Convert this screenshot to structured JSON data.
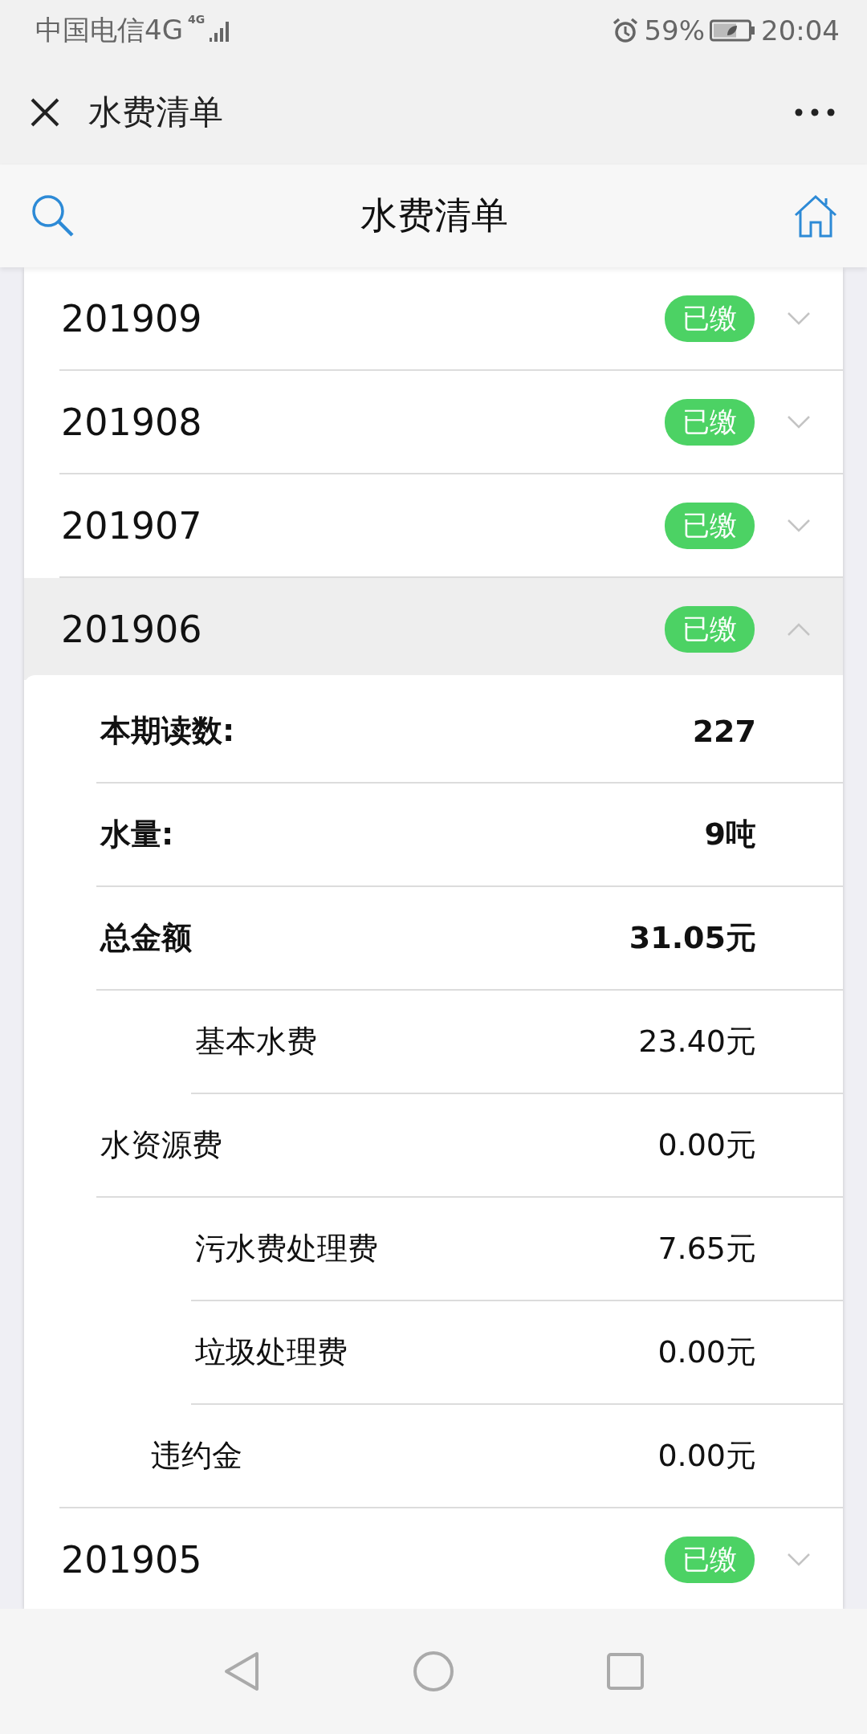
{
  "status_bar": {
    "carrier": "中国电信4G",
    "network": "4G",
    "battery": "59%",
    "time": "20:04"
  },
  "title_bar": {
    "title": "水费清单"
  },
  "header": {
    "title": "水费清单"
  },
  "months": [
    {
      "month": "201909",
      "status": "已缴",
      "expanded": false
    },
    {
      "month": "201908",
      "status": "已缴",
      "expanded": false
    },
    {
      "month": "201907",
      "status": "已缴",
      "expanded": false
    },
    {
      "month": "201906",
      "status": "已缴",
      "expanded": true,
      "details": [
        {
          "label": "本期读数:",
          "value": "227",
          "kind": "summary"
        },
        {
          "label": "水量:",
          "value": "9吨",
          "kind": "summary"
        },
        {
          "label": "总金额",
          "value": "31.05元",
          "kind": "summary"
        },
        {
          "label": "基本水费",
          "value": "23.40元",
          "kind": "subcharge"
        },
        {
          "label": "水资源费",
          "value": "0.00元",
          "kind": "charge"
        },
        {
          "label": "污水费处理费",
          "value": "7.65元",
          "kind": "subcharge"
        },
        {
          "label": "垃圾处理费",
          "value": "0.00元",
          "kind": "subcharge"
        },
        {
          "label": "违约金",
          "value": "0.00元",
          "kind": "penalty"
        }
      ]
    },
    {
      "month": "201905",
      "status": "已缴",
      "expanded": false
    }
  ]
}
